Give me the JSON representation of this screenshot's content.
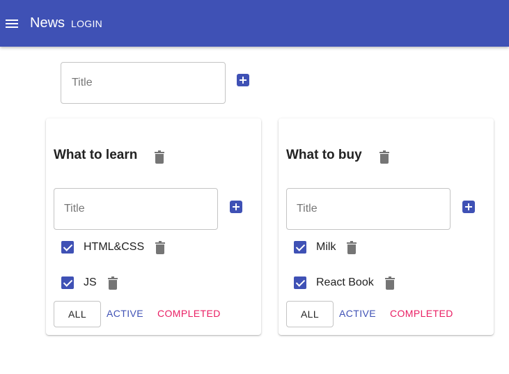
{
  "appbar": {
    "title": "News",
    "login_label": "LOGIN",
    "menu_icon": "menu-icon",
    "color": "#3f51b5"
  },
  "new_list": {
    "placeholder": "Title",
    "add_icon": "add-box-icon"
  },
  "lists": [
    {
      "title": "What to learn",
      "input_placeholder": "Title",
      "tasks": [
        {
          "label": "HTML&CSS",
          "checked": true
        },
        {
          "label": "JS",
          "checked": true
        }
      ],
      "filters": {
        "all": "ALL",
        "active": "ACTIVE",
        "completed": "COMPLETED"
      }
    },
    {
      "title": "What to buy",
      "input_placeholder": "Title",
      "tasks": [
        {
          "label": "Milk",
          "checked": true
        },
        {
          "label": "React Book",
          "checked": true
        }
      ],
      "filters": {
        "all": "ALL",
        "active": "ACTIVE",
        "completed": "COMPLETED"
      }
    }
  ],
  "colors": {
    "primary": "#3f51b5",
    "secondary": "#e91e63",
    "icon_grey": "#757575"
  }
}
